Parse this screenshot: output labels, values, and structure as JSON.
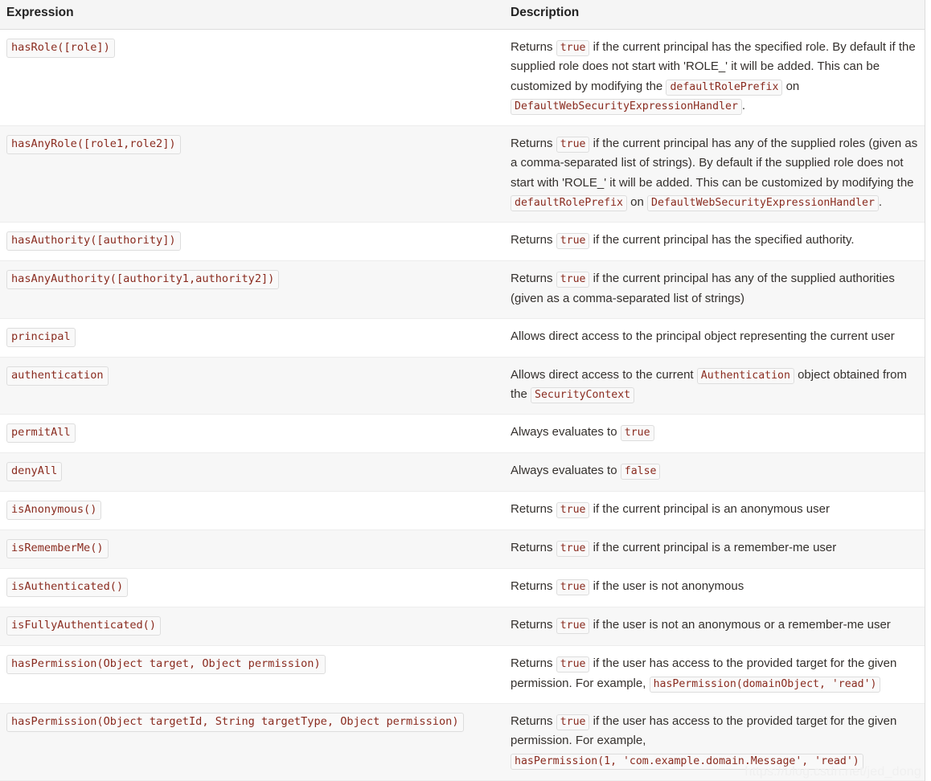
{
  "table": {
    "headers": {
      "expression": "Expression",
      "description": "Description"
    },
    "rows": [
      {
        "expression": "hasRole([role])",
        "description_parts": [
          {
            "type": "text",
            "value": "Returns "
          },
          {
            "type": "code",
            "value": "true"
          },
          {
            "type": "text",
            "value": " if the current principal has the specified role. By default if the supplied role does not start with 'ROLE_' it will be added. This can be customized by modifying the "
          },
          {
            "type": "code",
            "value": "defaultRolePrefix"
          },
          {
            "type": "text",
            "value": " on "
          },
          {
            "type": "code",
            "value": "DefaultWebSecurityExpressionHandler"
          },
          {
            "type": "text",
            "value": "."
          }
        ]
      },
      {
        "expression": "hasAnyRole([role1,role2])",
        "description_parts": [
          {
            "type": "text",
            "value": "Returns "
          },
          {
            "type": "code",
            "value": "true"
          },
          {
            "type": "text",
            "value": " if the current principal has any of the supplied roles (given as a comma-separated list of strings). By default if the supplied role does not start with 'ROLE_' it will be added. This can be customized by modifying the "
          },
          {
            "type": "code",
            "value": "defaultRolePrefix"
          },
          {
            "type": "text",
            "value": " on "
          },
          {
            "type": "code",
            "value": "DefaultWebSecurityExpressionHandler"
          },
          {
            "type": "text",
            "value": "."
          }
        ]
      },
      {
        "expression": "hasAuthority([authority])",
        "description_parts": [
          {
            "type": "text",
            "value": "Returns "
          },
          {
            "type": "code",
            "value": "true"
          },
          {
            "type": "text",
            "value": " if the current principal has the specified authority."
          }
        ]
      },
      {
        "expression": "hasAnyAuthority([authority1,authority2])",
        "description_parts": [
          {
            "type": "text",
            "value": "Returns "
          },
          {
            "type": "code",
            "value": "true"
          },
          {
            "type": "text",
            "value": " if the current principal has any of the supplied authorities (given as a comma-separated list of strings)"
          }
        ]
      },
      {
        "expression": "principal",
        "description_parts": [
          {
            "type": "text",
            "value": "Allows direct access to the principal object representing the current user"
          }
        ]
      },
      {
        "expression": "authentication",
        "description_parts": [
          {
            "type": "text",
            "value": "Allows direct access to the current "
          },
          {
            "type": "code",
            "value": "Authentication"
          },
          {
            "type": "text",
            "value": " object obtained from the "
          },
          {
            "type": "code",
            "value": "SecurityContext"
          }
        ]
      },
      {
        "expression": "permitAll",
        "description_parts": [
          {
            "type": "text",
            "value": "Always evaluates to "
          },
          {
            "type": "code",
            "value": "true"
          }
        ]
      },
      {
        "expression": "denyAll",
        "description_parts": [
          {
            "type": "text",
            "value": "Always evaluates to "
          },
          {
            "type": "code",
            "value": "false"
          }
        ]
      },
      {
        "expression": "isAnonymous()",
        "description_parts": [
          {
            "type": "text",
            "value": "Returns "
          },
          {
            "type": "code",
            "value": "true"
          },
          {
            "type": "text",
            "value": " if the current principal is an anonymous user"
          }
        ]
      },
      {
        "expression": "isRememberMe()",
        "description_parts": [
          {
            "type": "text",
            "value": "Returns "
          },
          {
            "type": "code",
            "value": "true"
          },
          {
            "type": "text",
            "value": " if the current principal is a remember-me user"
          }
        ]
      },
      {
        "expression": "isAuthenticated()",
        "description_parts": [
          {
            "type": "text",
            "value": "Returns "
          },
          {
            "type": "code",
            "value": "true"
          },
          {
            "type": "text",
            "value": " if the user is not anonymous"
          }
        ]
      },
      {
        "expression": "isFullyAuthenticated()",
        "description_parts": [
          {
            "type": "text",
            "value": "Returns "
          },
          {
            "type": "code",
            "value": "true"
          },
          {
            "type": "text",
            "value": " if the user is not an anonymous or a remember-me user"
          }
        ]
      },
      {
        "expression": "hasPermission(Object target, Object permission)",
        "description_parts": [
          {
            "type": "text",
            "value": "Returns "
          },
          {
            "type": "code",
            "value": "true"
          },
          {
            "type": "text",
            "value": " if the user has access to the provided target for the given permission. For example, "
          },
          {
            "type": "code",
            "value": "hasPermission(domainObject, 'read')"
          }
        ]
      },
      {
        "expression": "hasPermission(Object targetId, String targetType, Object permission)",
        "description_parts": [
          {
            "type": "text",
            "value": "Returns "
          },
          {
            "type": "code",
            "value": "true"
          },
          {
            "type": "text",
            "value": " if the user has access to the provided target for the given permission. For example, "
          },
          {
            "type": "code",
            "value": "hasPermission(1, 'com.example.domain.Message', 'read')"
          }
        ]
      }
    ]
  },
  "watermark": {
    "text": "https://blog.csdn.net/jed_dong"
  },
  "colors": {
    "header_bg": "#f5f5f5",
    "row_alt_bg": "#f7f7f7",
    "code_text": "#8a2b1f",
    "code_bg": "#f9f9f9",
    "code_border": "#dddddd",
    "body_text": "#34302d",
    "row_border": "#ededed"
  }
}
